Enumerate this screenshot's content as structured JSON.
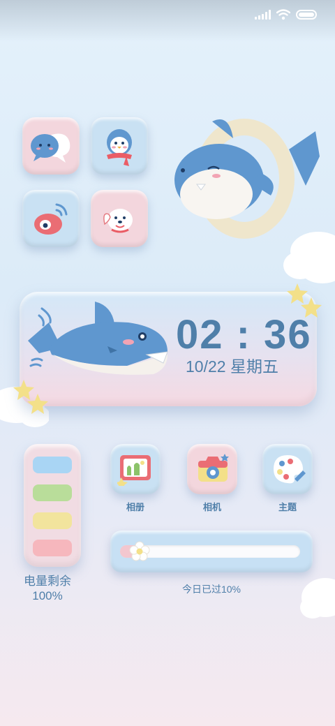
{
  "status_bar": {
    "signal_icon": "signal-icon",
    "wifi_icon": "wifi-icon",
    "battery_icon": "battery-icon"
  },
  "apps_top": [
    {
      "name": "chat-app",
      "icon": "chat-bubble-icon",
      "color": "#f3d6dd"
    },
    {
      "name": "penguin-app",
      "icon": "penguin-icon",
      "color": "#c9e1f3"
    },
    {
      "name": "weibo-app",
      "icon": "weibo-eye-icon",
      "color": "#c9e1f3"
    },
    {
      "name": "dog-app",
      "icon": "dog-icon",
      "color": "#f3d6dd"
    }
  ],
  "clock": {
    "time": "02 : 36",
    "date": "10/22 星期五"
  },
  "battery_widget": {
    "label_line1": "电量剩余",
    "label_line2": "100%",
    "cell_colors": [
      "#a9d5f4",
      "#b9dd9a",
      "#f2e49d",
      "#f6b7bd"
    ]
  },
  "apps_bottom": [
    {
      "label": "相册",
      "icon": "photo-album-icon"
    },
    {
      "label": "相机",
      "icon": "camera-icon"
    },
    {
      "label": "主题",
      "icon": "palette-icon"
    }
  ],
  "day_progress": {
    "label": "今日已过10%",
    "value": 0.1
  },
  "colors": {
    "accent_text": "#4f7fa9",
    "pink": "#f3d6dd",
    "blue": "#c9e1f3"
  }
}
